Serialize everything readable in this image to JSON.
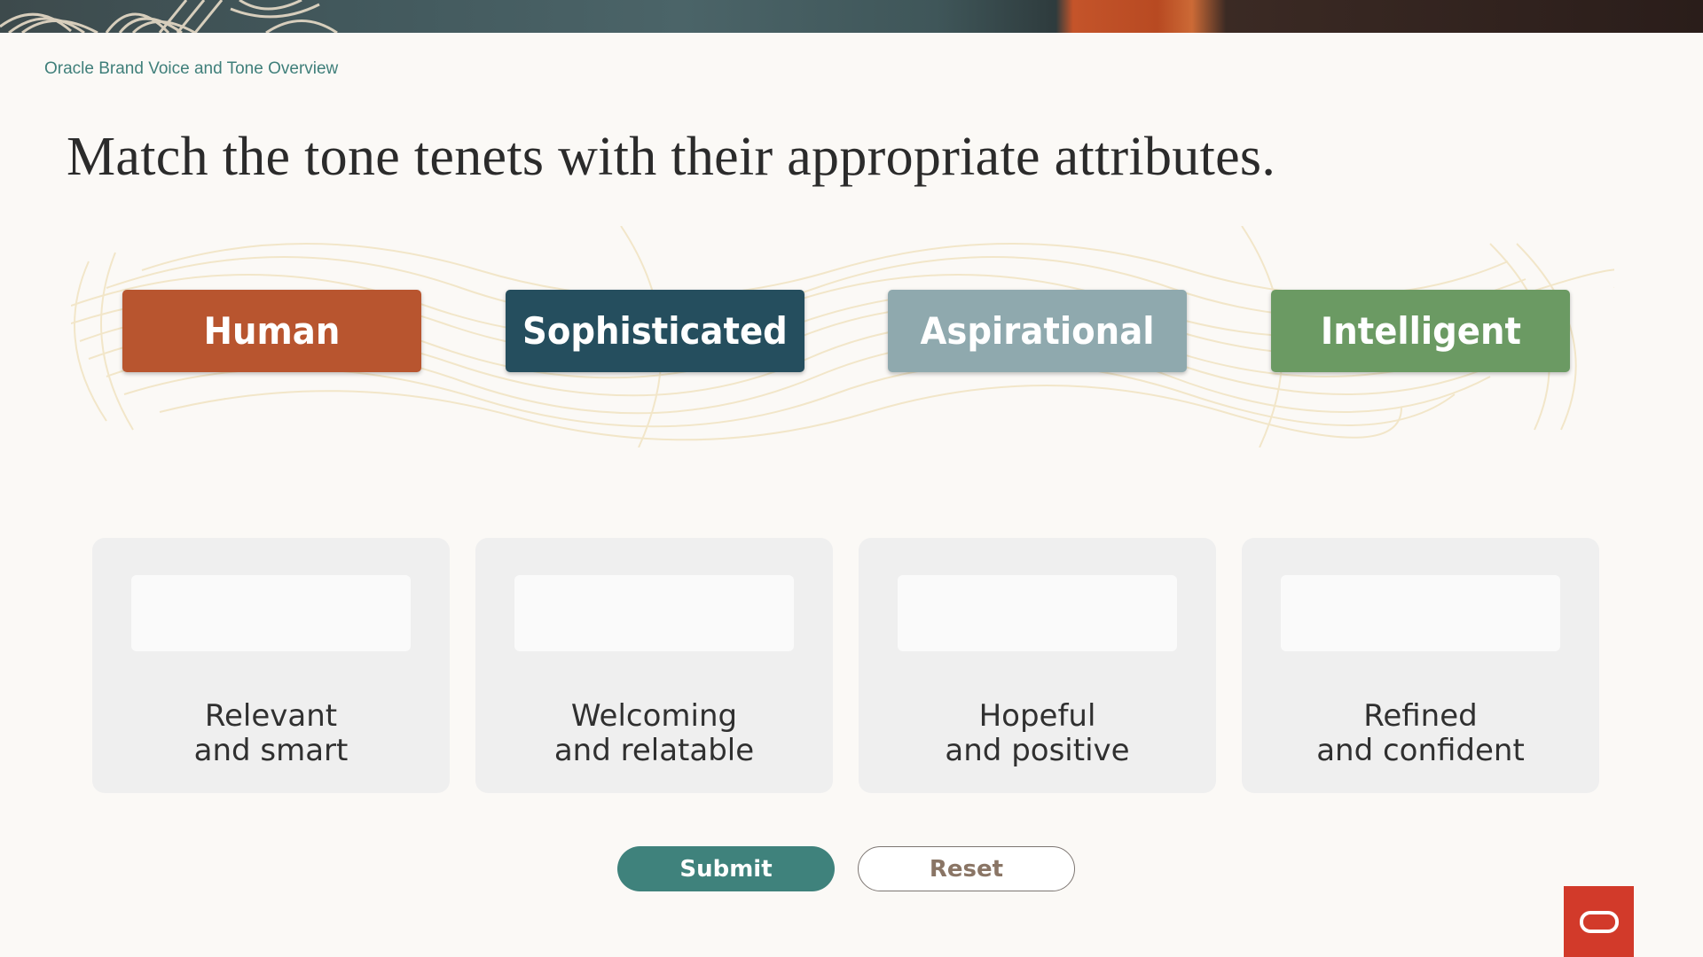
{
  "header": {
    "breadcrumb": "Oracle Brand Voice and Tone Overview",
    "title": "Match the tone tenets with their appropriate attributes."
  },
  "tenets": [
    {
      "label": "Human",
      "color": "#b8552f"
    },
    {
      "label": "Sophisticated",
      "color": "#254e5e"
    },
    {
      "label": "Aspirational",
      "color": "#8fa9ae"
    },
    {
      "label": "Intelligent",
      "color": "#6b9a63"
    }
  ],
  "targets": [
    {
      "attribute": "Relevant\nand smart"
    },
    {
      "attribute": "Welcoming\nand relatable"
    },
    {
      "attribute": "Hopeful\nand positive"
    },
    {
      "attribute": "Refined\nand confident"
    }
  ],
  "actions": {
    "submit_label": "Submit",
    "reset_label": "Reset"
  },
  "colors": {
    "accent": "#3f827c",
    "logo": "#d23a2a",
    "background": "#fbf9f6"
  }
}
